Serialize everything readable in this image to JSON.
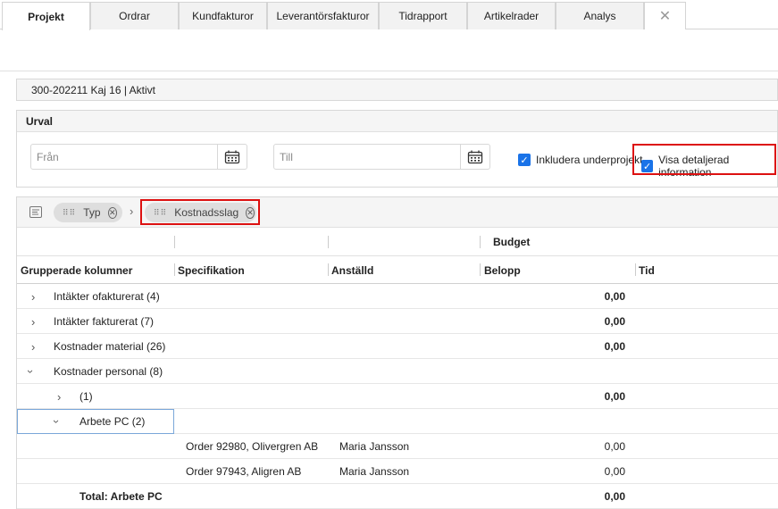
{
  "tabs": [
    {
      "label": "Projekt",
      "active": true
    },
    {
      "label": "Ordrar"
    },
    {
      "label": "Kundfakturor"
    },
    {
      "label": "Leverantörsfakturor"
    },
    {
      "label": "Tidrapport"
    },
    {
      "label": "Artikelrader"
    },
    {
      "label": "Analys"
    }
  ],
  "close_glyph": "✕",
  "project_info": "300-202211 Kaj 16 | Aktivt",
  "urval": {
    "title": "Urval",
    "from_placeholder": "Från",
    "to_placeholder": "Till",
    "include_subprojects": "Inkludera underprojekt",
    "show_detailed": "Visa detaljerad information"
  },
  "grouping": {
    "chips": [
      "Typ",
      "Kostnadsslag"
    ]
  },
  "columns": {
    "group_header": "Budget",
    "headers": [
      "Grupperade kolumner",
      "Specifikation",
      "Anställd",
      "Belopp",
      "Tid"
    ]
  },
  "rows": [
    {
      "label": "Intäkter ofakturerat (4)",
      "amount": "0,00",
      "level": 0,
      "expanded": false
    },
    {
      "label": "Intäkter fakturerat (7)",
      "amount": "0,00",
      "level": 0,
      "expanded": false
    },
    {
      "label": "Kostnader material (26)",
      "amount": "0,00",
      "level": 0,
      "expanded": false
    },
    {
      "label": "Kostnader personal (8)",
      "amount": "",
      "level": 0,
      "expanded": true
    },
    {
      "label": "(1)",
      "amount": "0,00",
      "level": 1,
      "expanded": false
    },
    {
      "label": "Arbete PC (2)",
      "amount": "",
      "level": 1,
      "expanded": true
    },
    {
      "spec": "Order 92980, Olivergren AB",
      "employee": "Maria Jansson",
      "amount": "0,00"
    },
    {
      "spec": "Order 97943, Aligren AB",
      "employee": "Maria Jansson",
      "amount": "0,00"
    },
    {
      "total": "Total: Arbete PC",
      "amount": "0,00"
    }
  ],
  "colors": {
    "accent": "#1a73e8",
    "highlight": "#dd1111"
  }
}
